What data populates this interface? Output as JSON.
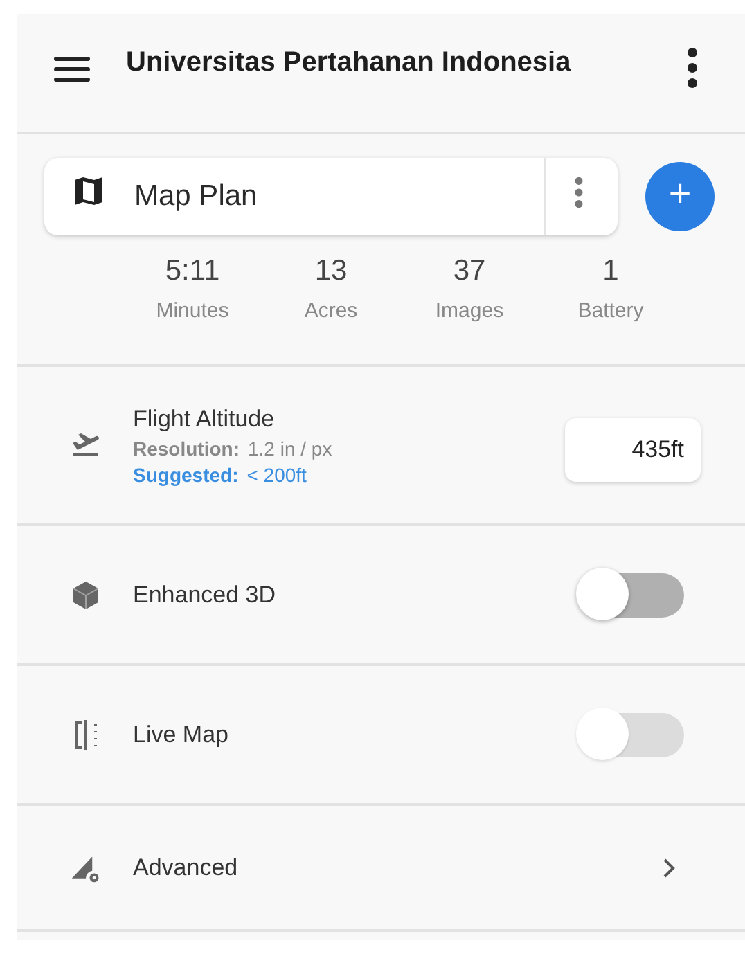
{
  "app_bar": {
    "title": "Universitas Pertahanan Indonesia"
  },
  "plan": {
    "name": "Map Plan",
    "add_label": "+"
  },
  "stats": [
    {
      "value": "5:11",
      "label": "Minutes"
    },
    {
      "value": "13",
      "label": "Acres"
    },
    {
      "value": "37",
      "label": "Images"
    },
    {
      "value": "1",
      "label": "Battery"
    }
  ],
  "settings": [
    {
      "kind": "altitude",
      "title": "Flight Altitude",
      "resolution_label": "Resolution:",
      "resolution": "1.2 in / px",
      "suggested_label": "Suggested:",
      "suggested": "< 200ft",
      "value": "435ft"
    },
    {
      "kind": "toggle",
      "title": "Enhanced 3D",
      "on": false,
      "disabled": false
    },
    {
      "kind": "toggle",
      "title": "Live Map",
      "on": false,
      "disabled": true
    },
    {
      "kind": "link",
      "title": "Advanced"
    }
  ]
}
